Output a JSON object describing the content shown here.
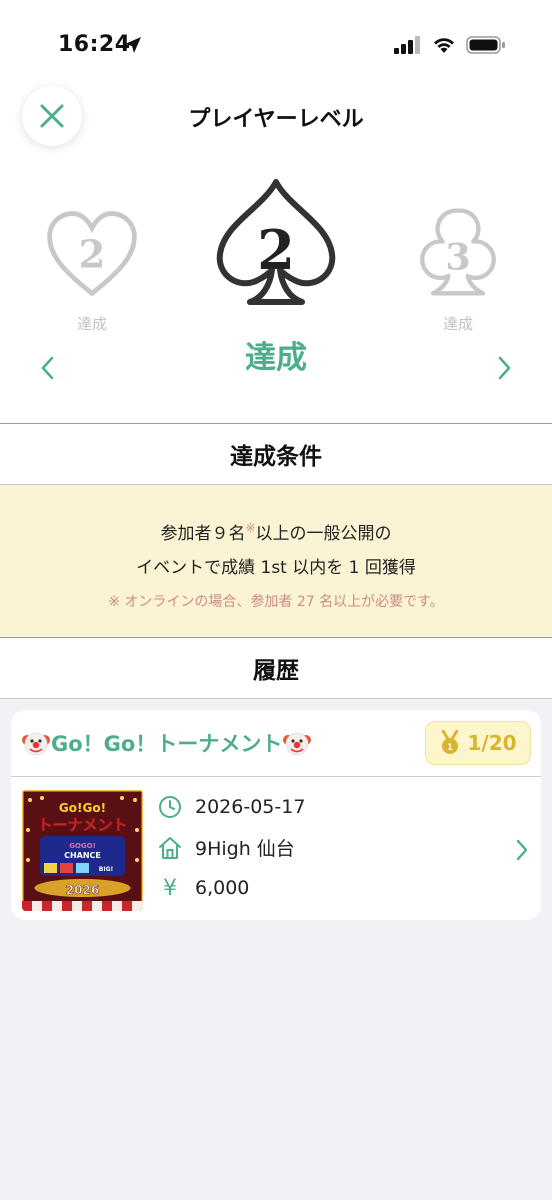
{
  "status_bar": {
    "time": "16:24"
  },
  "header": {
    "title": "プレイヤーレベル"
  },
  "levels": {
    "prev": {
      "number": "2",
      "status": "達成"
    },
    "current": {
      "number": "2",
      "status": "達成"
    },
    "next": {
      "number": "3",
      "status": "達成"
    }
  },
  "sections": {
    "condition_title": "達成条件",
    "history_title": "履歴"
  },
  "condition": {
    "line1_before": "参加者９名",
    "line1_mark": "※",
    "line1_after": "以上の一般公開の",
    "line2": "イベントで成績 1st 以内を 1 回獲得",
    "note": "※ オンラインの場合、参加者 27 名以上が必要です。"
  },
  "history": [
    {
      "title": "Go！Go！トーナメント",
      "rank": "1/20",
      "date": "2026-05-17",
      "venue": "9High 仙台",
      "fee": "6,000",
      "fee_symbol": "¥",
      "thumb_text": {
        "top": "Go!Go!",
        "main": "トーナメント",
        "gogo": "GOGO!",
        "chance": "CHANCE",
        "big": "BIG!",
        "year": "2026"
      }
    }
  ],
  "colors": {
    "accent": "#4cae8c",
    "condition_bg": "#fbf4d4",
    "note": "#cf8a86",
    "badge": "#d7b52c"
  }
}
